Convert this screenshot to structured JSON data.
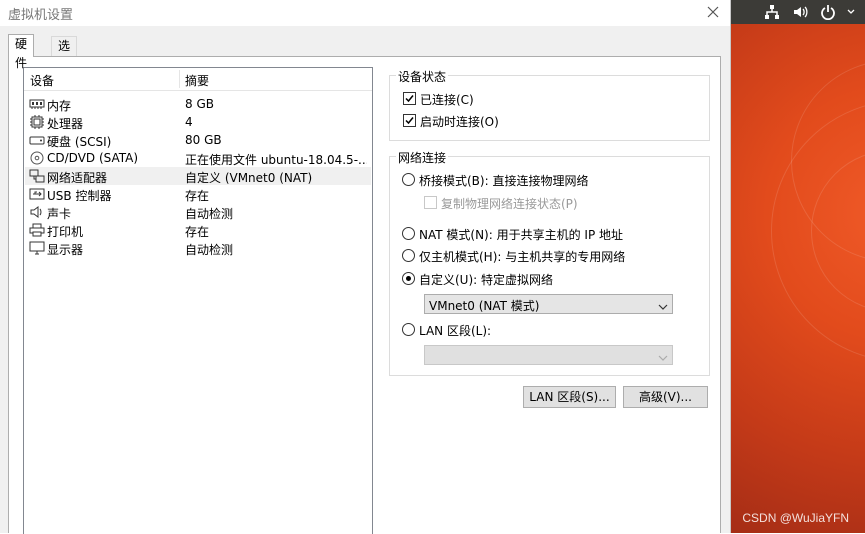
{
  "window": {
    "title": "虚拟机设置"
  },
  "tabs": [
    {
      "label": "硬件"
    },
    {
      "label": "选项"
    }
  ],
  "device_list": {
    "headers": {
      "device": "设备",
      "summary": "摘要"
    },
    "rows": [
      {
        "name": "内存",
        "summary": "8 GB",
        "icon": "memory-icon"
      },
      {
        "name": "处理器",
        "summary": "4",
        "icon": "cpu-icon"
      },
      {
        "name": "硬盘 (SCSI)",
        "summary": "80 GB",
        "icon": "harddisk-icon"
      },
      {
        "name": "CD/DVD (SATA)",
        "summary": "正在使用文件 ubuntu-18.04.5-...",
        "icon": "cd-icon"
      },
      {
        "name": "网络适配器",
        "summary": "自定义 (VMnet0 (NAT)",
        "icon": "network-icon",
        "selected": true
      },
      {
        "name": "USB 控制器",
        "summary": "存在",
        "icon": "usb-icon"
      },
      {
        "name": "声卡",
        "summary": "自动检测",
        "icon": "speaker-icon"
      },
      {
        "name": "打印机",
        "summary": "存在",
        "icon": "printer-icon"
      },
      {
        "name": "显示器",
        "summary": "自动检测",
        "icon": "monitor-icon"
      }
    ]
  },
  "device_status": {
    "title": "设备状态",
    "connected": {
      "label": "已连接(C)",
      "checked": true
    },
    "connect_at_power_on": {
      "label": "启动时连接(O)",
      "checked": true
    }
  },
  "network": {
    "title": "网络连接",
    "bridged": {
      "label": "桥接模式(B): 直接连接物理网络",
      "selected": false
    },
    "replicate": {
      "label": "复制物理网络连接状态(P)",
      "checked": false,
      "disabled": true
    },
    "nat": {
      "label": "NAT 模式(N): 用于共享主机的 IP 地址",
      "selected": false
    },
    "host_only": {
      "label": "仅主机模式(H): 与主机共享的专用网络",
      "selected": false
    },
    "custom": {
      "label": "自定义(U): 特定虚拟网络",
      "selected": true
    },
    "custom_select": {
      "value": "VMnet0 (NAT 模式)"
    },
    "lan_segment": {
      "label": "LAN 区段(L):",
      "selected": false
    },
    "lan_select": {
      "value": ""
    }
  },
  "buttons": {
    "lan_segments": "LAN 区段(S)...",
    "advanced": "高级(V)..."
  },
  "desktop": {
    "watermark": "CSDN @WuJiaYFN"
  }
}
